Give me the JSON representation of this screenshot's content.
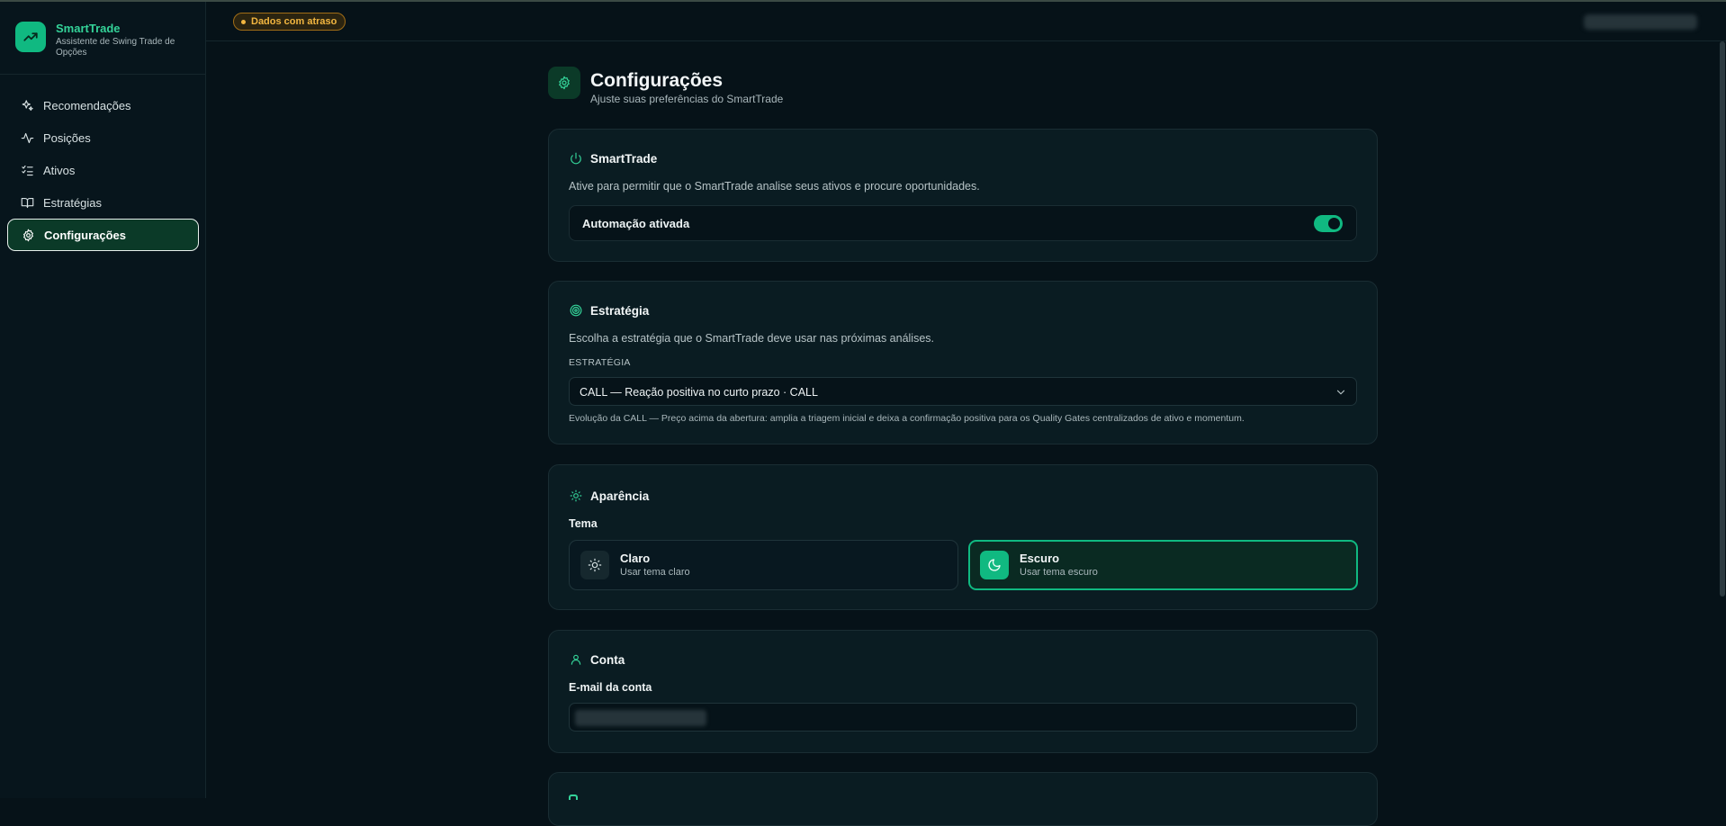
{
  "app": {
    "name": "SmartTrade",
    "subtitle": "Assistente de Swing Trade de Opções"
  },
  "sidebar": {
    "items": [
      {
        "label": "Recomendações",
        "icon": "sparkles-icon"
      },
      {
        "label": "Posições",
        "icon": "activity-icon"
      },
      {
        "label": "Ativos",
        "icon": "list-checks-icon"
      },
      {
        "label": "Estratégias",
        "icon": "book-open-icon"
      },
      {
        "label": "Configurações",
        "icon": "gear-icon",
        "active": true
      }
    ]
  },
  "topbar": {
    "status_badge": "Dados com atraso"
  },
  "page": {
    "title": "Configurações",
    "subtitle": "Ajuste suas preferências do SmartTrade"
  },
  "smarttrade_card": {
    "title": "SmartTrade",
    "description": "Ative para permitir que o SmartTrade analise seus ativos e procure oportunidades.",
    "toggle_label": "Automação ativada",
    "toggle_on": true
  },
  "strategy_card": {
    "title": "Estratégia",
    "description": "Escolha a estratégia que o SmartTrade deve usar nas próximas análises.",
    "field_label": "ESTRATÉGIA",
    "selected": "CALL — Reação positiva no curto prazo · CALL",
    "hint": "Evolução da CALL — Preço acima da abertura: amplia a triagem inicial e deixa a confirmação positiva para os Quality Gates centralizados de ativo e momentum."
  },
  "appearance_card": {
    "title": "Aparência",
    "theme_label": "Tema",
    "options": [
      {
        "name": "Claro",
        "desc": "Usar tema claro",
        "selected": false
      },
      {
        "name": "Escuro",
        "desc": "Usar tema escuro",
        "selected": true
      }
    ]
  },
  "account_card": {
    "title": "Conta",
    "email_label": "E-mail da conta"
  },
  "colors": {
    "accent": "#10b981",
    "background": "#061218",
    "card": "#0a1c22",
    "warning": "#f2b640"
  }
}
